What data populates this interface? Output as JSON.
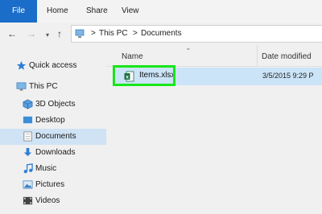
{
  "ribbon": {
    "tabs": [
      "File",
      "Home",
      "Share",
      "View"
    ]
  },
  "nav": {
    "back": "←",
    "forward": "→",
    "recent": "▾",
    "up": "↑",
    "breadcrumb": [
      "This PC",
      "Documents"
    ],
    "separator": ">"
  },
  "sidebar": {
    "items": [
      {
        "label": "Quick access",
        "icon": "star-icon"
      },
      {
        "label": "This PC",
        "icon": "computer-icon"
      },
      {
        "label": "3D Objects",
        "icon": "cube-icon"
      },
      {
        "label": "Desktop",
        "icon": "desktop-icon"
      },
      {
        "label": "Documents",
        "icon": "documents-icon",
        "selected": true
      },
      {
        "label": "Downloads",
        "icon": "download-icon"
      },
      {
        "label": "Music",
        "icon": "music-icon"
      },
      {
        "label": "Pictures",
        "icon": "pictures-icon"
      },
      {
        "label": "Videos",
        "icon": "video-icon"
      }
    ]
  },
  "list": {
    "columns": {
      "name": "Name",
      "date": "Date modified"
    },
    "files": [
      {
        "name": "Items.xlsx",
        "date": "3/5/2015 9:29 P",
        "icon": "excel-file-icon",
        "highlighted": true
      }
    ]
  },
  "colors": {
    "file_tab": "#1a6ec9",
    "selection": "#cce4f7",
    "highlight_box": "#19e619",
    "excel": "#1e7145"
  }
}
